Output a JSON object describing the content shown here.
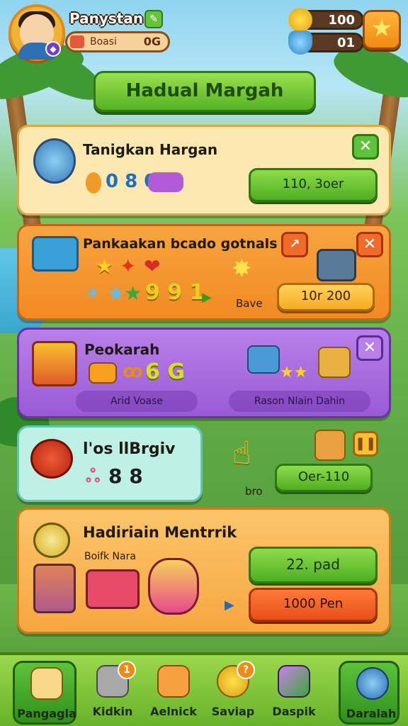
{
  "player": {
    "name": "Panystan",
    "badge_label": "Boasi",
    "badge_value": "0G"
  },
  "resources": {
    "gold": "100",
    "gems": "01"
  },
  "title_button": "Hadual Margah",
  "cards": {
    "c1": {
      "title": "Tanigkan Hargan",
      "numbers": "0 8 0",
      "button": "110, 3oer"
    },
    "c2": {
      "title": "Pankaakan bcado ɡotnals",
      "digits": "9 9 1",
      "label": "Bave",
      "button": "10r 200"
    },
    "c3": {
      "title": "Peokarah",
      "digits": "6 G",
      "pill_left": "Arid Voase",
      "pill_right": "Rason Nlain Dahin"
    },
    "c4": {
      "title": "l'os llBrgiv",
      "numbers": "8 8",
      "label": "bro",
      "button": "Oer-110"
    },
    "c5": {
      "title": "Hadiriain Mentrrik",
      "subtitle": "Boifk Nara",
      "button_green": "22. pad",
      "button_red": "1000 Pen"
    }
  },
  "nav": {
    "items": [
      {
        "label": "Pangagla",
        "icon": "house-icon"
      },
      {
        "label": "Kidkin",
        "icon": "stone-icon",
        "badge": "1"
      },
      {
        "label": "Aelnick",
        "icon": "book-icon"
      },
      {
        "label": "Saviap",
        "icon": "coin-icon",
        "badge": "?"
      },
      {
        "label": "Daspik",
        "icon": "pencil-icon"
      },
      {
        "label": "Daralah",
        "icon": "gear-icon"
      }
    ]
  },
  "colors": {
    "green": "#55b225",
    "orange": "#f28a22",
    "purple": "#9a5ad6",
    "teal": "#5fc6b4"
  }
}
